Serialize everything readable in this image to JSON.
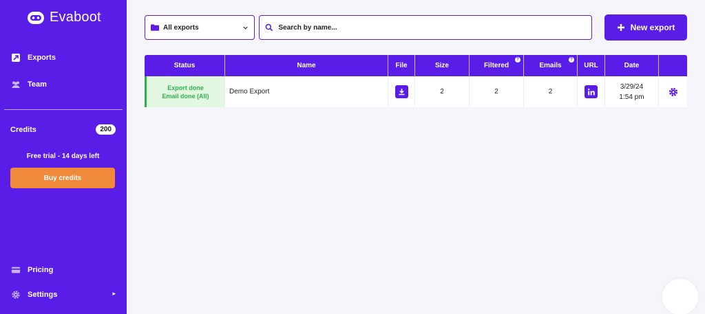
{
  "app": {
    "logo_text": "Evaboot"
  },
  "sidebar": {
    "nav": [
      {
        "label": "Exports",
        "icon": "export-icon"
      },
      {
        "label": "Team",
        "icon": "team-icon"
      }
    ],
    "credits_label": "Credits",
    "credits_count": "200",
    "trial_text": "Free trial - 14 days left",
    "buy_label": "Buy credits",
    "bottom_nav": [
      {
        "label": "Pricing",
        "icon": "card-icon"
      },
      {
        "label": "Settings",
        "icon": "gear-icon"
      }
    ]
  },
  "toolbar": {
    "filter_value": "All exports",
    "search_placeholder": "Search by name...",
    "new_export_label": "New export"
  },
  "table": {
    "headers": [
      "Status",
      "Name",
      "File",
      "Size",
      "Filtered",
      "Emails",
      "URL",
      "Date",
      ""
    ],
    "rows": [
      {
        "status_line1": "Export done",
        "status_line2": "Email done (All)",
        "name": "Demo Export",
        "size": "2",
        "filtered": "2",
        "emails": "2",
        "date_line1": "3/29/24",
        "date_line2": "1:54 pm"
      }
    ]
  },
  "colors": {
    "brand": "#5a1de8",
    "accent": "#f0893a",
    "success": "#2bb24c"
  }
}
